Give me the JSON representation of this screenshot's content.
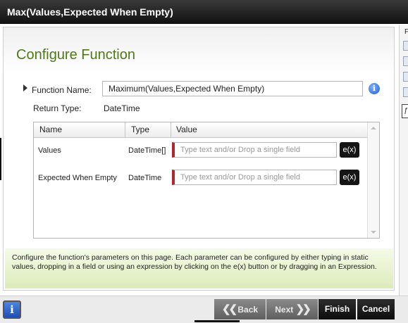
{
  "window": {
    "title": "Max(Values,Expected When Empty)"
  },
  "page": {
    "title": "Configure Function"
  },
  "function": {
    "name_label": "Function Name:",
    "name_value": "Maximum(Values,Expected When Empty)",
    "return_label": "Return Type:",
    "return_value": "DateTime"
  },
  "grid": {
    "columns": [
      "Name",
      "Type",
      "Value"
    ],
    "rows": [
      {
        "name": "Values",
        "type": "DateTime[]",
        "placeholder": "Type text and/or Drop a single field",
        "button": "e(x)"
      },
      {
        "name": "Expected When Empty",
        "type": "DateTime",
        "placeholder": "Type text and/or Drop a single field",
        "button": "e(x)"
      }
    ]
  },
  "help": {
    "text": "Configure the function's parameters on this page.  Each parameter can be configured by either typing in static values, dropping in a field or using an expression by clicking on the e(x) button or by dragging in an Expression."
  },
  "footer": {
    "back": "Back",
    "next": "Next",
    "finish": "Finish",
    "cancel": "Cancel",
    "info_glyph": "i"
  },
  "right_panel": {
    "letter": "F",
    "selected_glyph": "ƒ"
  },
  "icons": [
    "info-icon",
    "expand-arrow-icon",
    "back-chevron-icon",
    "next-chevron-icon"
  ],
  "colors": {
    "title_green": "#4d7a14",
    "required_marker": "#b3262b",
    "help_bg": "#dcebb9"
  }
}
